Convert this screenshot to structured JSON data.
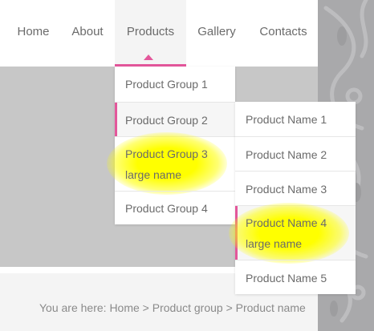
{
  "nav": {
    "items": [
      {
        "label": "Home"
      },
      {
        "label": "About"
      },
      {
        "label": "Products"
      },
      {
        "label": "Gallery"
      },
      {
        "label": "Contacts"
      }
    ],
    "active_index": 2
  },
  "submenu": {
    "items": [
      {
        "line1": "Product Group 1",
        "line2": ""
      },
      {
        "line1": "Product Group 2",
        "line2": ""
      },
      {
        "line1": "Product Group 3",
        "line2": "large name"
      },
      {
        "line1": "Product Group 4",
        "line2": ""
      }
    ],
    "hovered_index": 1
  },
  "subsubmenu": {
    "items": [
      {
        "line1": "Product Name 1",
        "line2": ""
      },
      {
        "line1": "Product Name 2",
        "line2": ""
      },
      {
        "line1": "Product Name 3",
        "line2": ""
      },
      {
        "line1": "Product Name 4",
        "line2": "large name"
      },
      {
        "line1": "Product Name 5",
        "line2": ""
      }
    ],
    "hovered_index": 3
  },
  "breadcrumb": {
    "text": "You are here: Home > Product group > Product name"
  },
  "colors": {
    "accent": "#e3579b",
    "highlight": "#ffff00",
    "banner": "#c7c7c7",
    "text": "#6b6b6b"
  }
}
